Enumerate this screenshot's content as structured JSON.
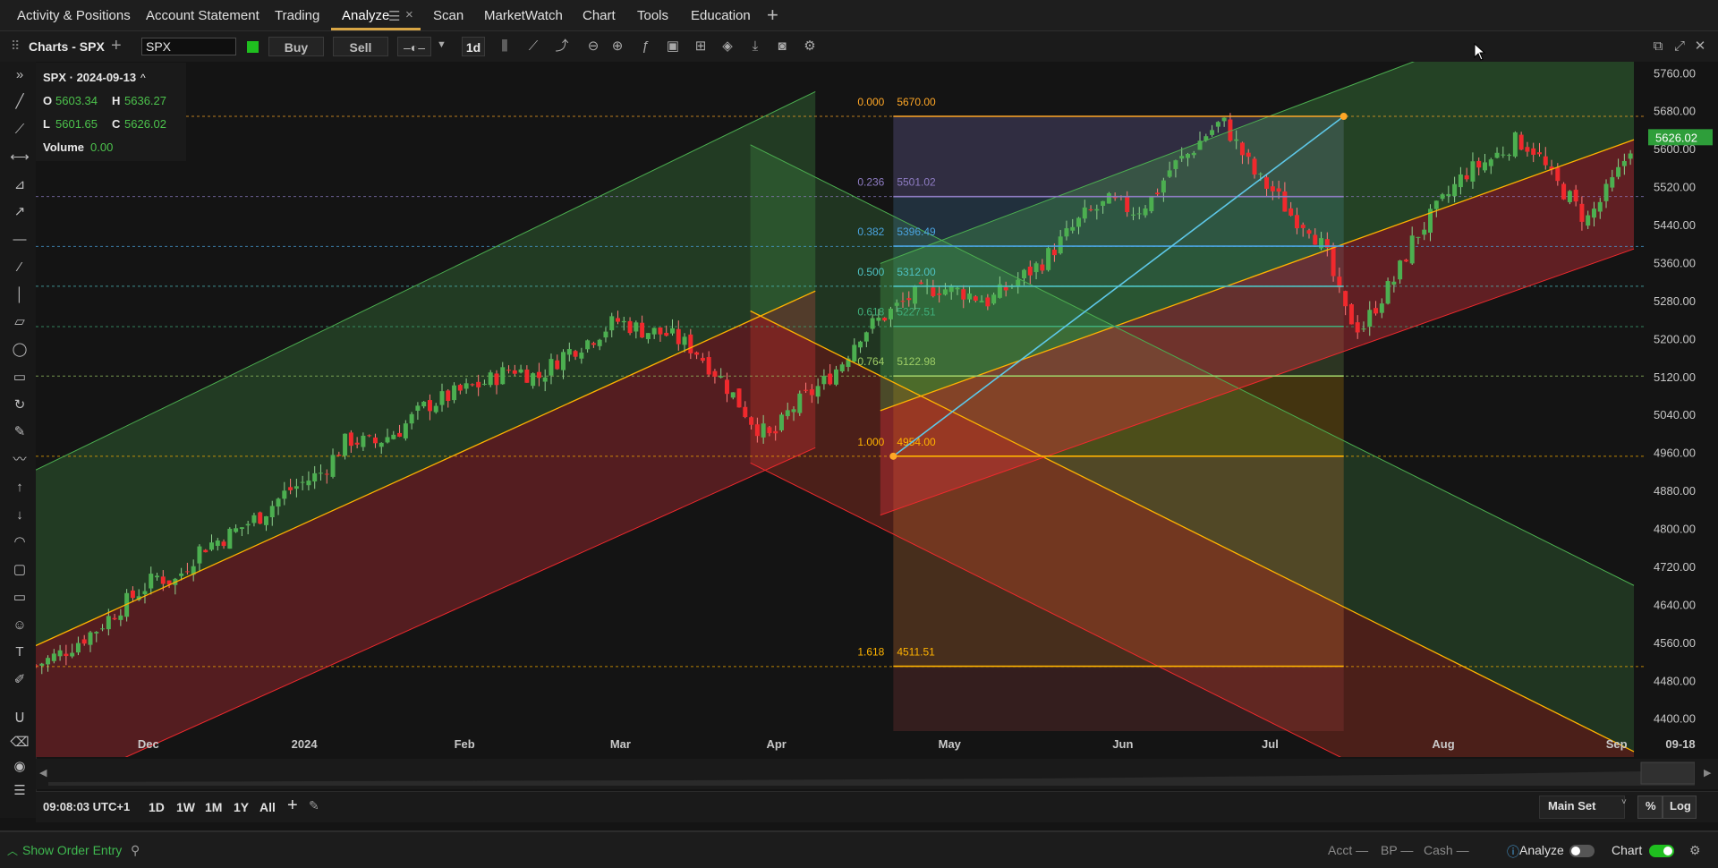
{
  "tabs": [
    {
      "label": "Activity & Positions"
    },
    {
      "label": "Account Statement"
    },
    {
      "label": "Trading"
    },
    {
      "label": "Analyze"
    },
    {
      "label": "Scan"
    },
    {
      "label": "MarketWatch"
    },
    {
      "label": "Chart"
    },
    {
      "label": "Tools"
    },
    {
      "label": "Education"
    }
  ],
  "add_tab": "+",
  "toolbar": {
    "title": "Charts - SPX",
    "add": "+",
    "symbol": "SPX",
    "buy": "Buy",
    "sell": "Sell",
    "interval": "1d",
    "accent_color": "#1fbf1f"
  },
  "ohlc": {
    "header": "SPX · 2024-09-13",
    "chevron": "^",
    "o_label": "O",
    "o": "5603.34",
    "h_label": "H",
    "h": "5636.27",
    "l_label": "L",
    "l": "5601.65",
    "c_label": "C",
    "c": "5626.02",
    "vol_label": "Volume",
    "vol": "0.00"
  },
  "chart_data": {
    "type": "candlestick",
    "symbol": "SPX",
    "interval": "1d",
    "price_axis": [
      "5760.00",
      "5680.00",
      "5600.00",
      "5520.00",
      "5440.00",
      "5360.00",
      "5280.00",
      "5200.00",
      "5120.00",
      "5040.00",
      "4960.00",
      "4880.00",
      "4800.00",
      "4720.00",
      "4640.00",
      "4560.00",
      "4480.00",
      "4400.00"
    ],
    "time_axis": [
      "Dec",
      "2024",
      "Feb",
      "Mar",
      "Apr",
      "May",
      "Jun",
      "Jul",
      "Aug",
      "Sep",
      "09-18"
    ],
    "last_price": "5626.02",
    "ylim": [
      4375,
      5785
    ],
    "fibonacci": [
      {
        "ratio": "0.000",
        "price": "5670.00",
        "color": "#ffa726"
      },
      {
        "ratio": "0.236",
        "price": "5501.02",
        "color": "#8e7cc3"
      },
      {
        "ratio": "0.382",
        "price": "5396.49",
        "color": "#4aa3df"
      },
      {
        "ratio": "0.500",
        "price": "5312.00",
        "color": "#4fc3c3"
      },
      {
        "ratio": "0.618",
        "price": "5227.51",
        "color": "#3fae7a"
      },
      {
        "ratio": "0.764",
        "price": "5122.98",
        "color": "#9ccc65"
      },
      {
        "ratio": "1.000",
        "price": "4954.00",
        "color": "#ffb300"
      },
      {
        "ratio": "1.618",
        "price": "4511.51",
        "color": "#ffb300"
      }
    ],
    "close_path": [
      [
        0,
        4513
      ],
      [
        6,
        4540
      ],
      [
        14,
        4590
      ],
      [
        20,
        4640
      ],
      [
        28,
        4700
      ],
      [
        32,
        4690
      ],
      [
        38,
        4760
      ],
      [
        44,
        4785
      ],
      [
        52,
        4830
      ],
      [
        58,
        4880
      ],
      [
        66,
        4920
      ],
      [
        72,
        4990
      ],
      [
        78,
        4980
      ],
      [
        84,
        5010
      ],
      [
        90,
        5060
      ],
      [
        98,
        5090
      ],
      [
        104,
        5110
      ],
      [
        110,
        5140
      ],
      [
        116,
        5120
      ],
      [
        122,
        5170
      ],
      [
        128,
        5200
      ],
      [
        134,
        5240
      ],
      [
        140,
        5220
      ],
      [
        146,
        5210
      ],
      [
        152,
        5180
      ],
      [
        158,
        5120
      ],
      [
        162,
        5070
      ],
      [
        166,
        5020
      ],
      [
        170,
        4990
      ],
      [
        174,
        5050
      ],
      [
        178,
        5080
      ],
      [
        182,
        5110
      ],
      [
        186,
        5150
      ],
      [
        190,
        5210
      ],
      [
        196,
        5250
      ],
      [
        202,
        5290
      ],
      [
        208,
        5310
      ],
      [
        214,
        5300
      ],
      [
        220,
        5280
      ],
      [
        226,
        5320
      ],
      [
        232,
        5360
      ],
      [
        238,
        5420
      ],
      [
        242,
        5460
      ],
      [
        248,
        5490
      ],
      [
        254,
        5470
      ],
      [
        258,
        5500
      ],
      [
        262,
        5560
      ],
      [
        266,
        5590
      ],
      [
        270,
        5630
      ],
      [
        274,
        5660
      ],
      [
        278,
        5600
      ],
      [
        282,
        5540
      ],
      [
        286,
        5510
      ],
      [
        290,
        5460
      ],
      [
        294,
        5440
      ],
      [
        298,
        5380
      ],
      [
        302,
        5260
      ],
      [
        306,
        5220
      ],
      [
        310,
        5280
      ],
      [
        314,
        5330
      ],
      [
        318,
        5410
      ],
      [
        324,
        5480
      ],
      [
        330,
        5550
      ],
      [
        336,
        5580
      ],
      [
        342,
        5620
      ],
      [
        346,
        5600
      ],
      [
        350,
        5540
      ],
      [
        354,
        5500
      ],
      [
        358,
        5450
      ],
      [
        362,
        5500
      ],
      [
        366,
        5560
      ],
      [
        369,
        5626
      ]
    ]
  },
  "bottom": {
    "time": "09:08:03 UTC+1",
    "ranges": [
      "1D",
      "1W",
      "1M",
      "1Y",
      "All"
    ],
    "add": "+",
    "main_set": "Main Set",
    "percent": "%",
    "log": "Log"
  },
  "statusbar": {
    "show_order_entry": "Show Order Entry",
    "acct": "Acct —",
    "bp": "BP —",
    "cash": "Cash —",
    "analyze": "Analyze",
    "chart": "Chart",
    "chart_toggle_on": true,
    "analyze_toggle_on": false
  }
}
